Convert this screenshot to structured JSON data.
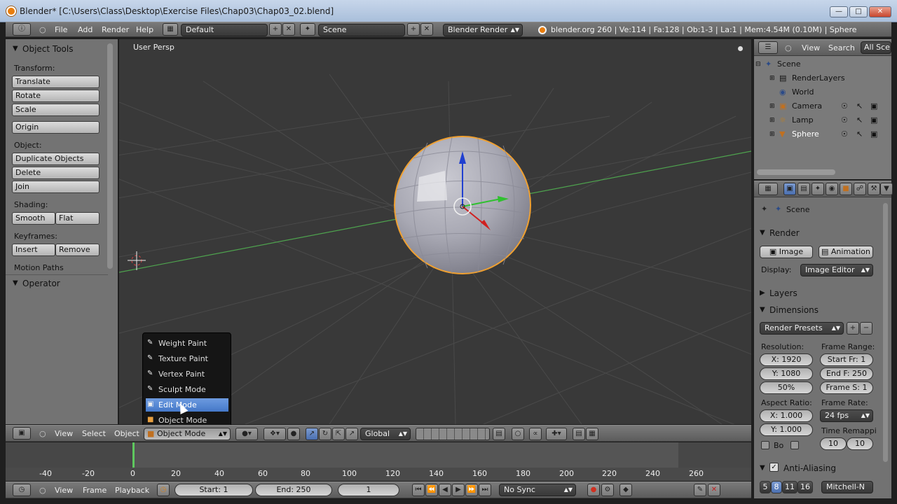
{
  "window": {
    "title": "Blender* [C:\\Users\\Class\\Desktop\\Exercise Files\\Chap03\\Chap03_02.blend]"
  },
  "info_header": {
    "menus": [
      "File",
      "Add",
      "Render",
      "Help"
    ],
    "layout": "Default",
    "scene": "Scene",
    "engine": "Blender Render",
    "stats": "blender.org 260 | Ve:114 | Fa:128 | Ob:1-3 | La:1 | Mem:4.54M (0.10M) | Sphere"
  },
  "toolshelf": {
    "title": "Object Tools",
    "transform_label": "Transform:",
    "translate": "Translate",
    "rotate": "Rotate",
    "scale": "Scale",
    "origin": "Origin",
    "object_label": "Object:",
    "duplicate": "Duplicate Objects",
    "delete": "Delete",
    "join": "Join",
    "shading_label": "Shading:",
    "smooth": "Smooth",
    "flat": "Flat",
    "keyframes_label": "Keyframes:",
    "insert": "Insert",
    "remove": "Remove",
    "motion_paths": "Motion Paths",
    "operator": "Operator"
  },
  "viewport": {
    "label": "User Persp"
  },
  "mode_menu": {
    "items": [
      "Weight Paint",
      "Texture Paint",
      "Vertex Paint",
      "Sculpt Mode",
      "Edit Mode",
      "Object Mode"
    ],
    "selected": "Edit Mode"
  },
  "view3d_header": {
    "menus": [
      "View",
      "Select",
      "Object"
    ],
    "mode": "Object Mode",
    "orientation": "Global"
  },
  "timeline": {
    "ticks": [
      "-40",
      "-20",
      "0",
      "20",
      "40",
      "60",
      "80",
      "100",
      "120",
      "140",
      "160",
      "180",
      "200",
      "220",
      "240",
      "260"
    ]
  },
  "timeline_header": {
    "menus": [
      "View",
      "Frame",
      "Playback"
    ],
    "start": "Start: 1",
    "end": "End: 250",
    "current": "1",
    "sync": "No Sync"
  },
  "outliner": {
    "menus": [
      "View",
      "Search"
    ],
    "filter": "All Sce",
    "items": [
      "Scene",
      "RenderLayers",
      "World",
      "Camera",
      "Lamp",
      "Sphere"
    ]
  },
  "properties": {
    "context": "Scene",
    "render_panel": "Render",
    "image": "Image",
    "animation": "Animation",
    "display_label": "Display:",
    "display": "Image Editor",
    "layers_panel": "Layers",
    "dimensions_panel": "Dimensions",
    "presets": "Render Presets",
    "resolution_label": "Resolution:",
    "res_x": "X: 1920",
    "res_y": "Y: 1080",
    "res_pct": "50%",
    "frame_range_label": "Frame Range:",
    "start_fr": "Start Fr: 1",
    "end_f": "End F: 250",
    "frame_s": "Frame S: 1",
    "aspect_label": "Aspect Ratio:",
    "asp_x": "X: 1.000",
    "asp_y": "Y: 1.000",
    "frame_rate_label": "Frame Rate:",
    "fps": "24 fps",
    "time_remap_label": "Time Remappi",
    "remap_old": "10",
    "remap_new": "10",
    "border": "Bo",
    "aa_panel": "Anti-Aliasing",
    "aa_samples": [
      "5",
      "8",
      "11",
      "16"
    ],
    "aa_filter": "Mitchell-N"
  },
  "colors": {
    "viewport_bg": "#393939",
    "grid": "#4a4a4a",
    "selection_outline": "#f0a030",
    "menu_highlight": "#5588d8",
    "x_axis": "#c82020",
    "y_axis": "#2ea82e",
    "z_axis": "#2040c8"
  }
}
